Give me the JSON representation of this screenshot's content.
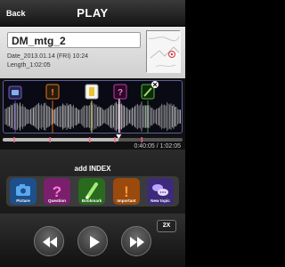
{
  "header": {
    "back_label": "Back",
    "title": "PLAY"
  },
  "file": {
    "name": "DM_mtg_2",
    "date": "Date_2013.01.14 (FRI) 10:24",
    "length": "Length_1:02:05"
  },
  "player": {
    "time_display": "0:40:05 / 1:02:05",
    "position_fraction": 0.645
  },
  "index_panel": {
    "title": "add INDEX",
    "buttons": [
      {
        "label": "Picture",
        "icon": "camera-icon",
        "color": "#2f86d6"
      },
      {
        "label": "Question",
        "icon": "question-mark-icon",
        "color": "#b02c9c"
      },
      {
        "label": "Bookmark",
        "icon": "pen-icon",
        "color": "#3e9e2e"
      },
      {
        "label": "Important",
        "icon": "exclamation-icon",
        "color": "#d96a10"
      },
      {
        "label": "New topic",
        "icon": "speech-bubbles-icon",
        "color": "#5b3fb1"
      }
    ]
  },
  "transport": {
    "speed_label": "2X"
  },
  "colors": {
    "waveform": "#e0e0e0",
    "playhead": "#ffffff",
    "progress": "#ff5a8a"
  }
}
